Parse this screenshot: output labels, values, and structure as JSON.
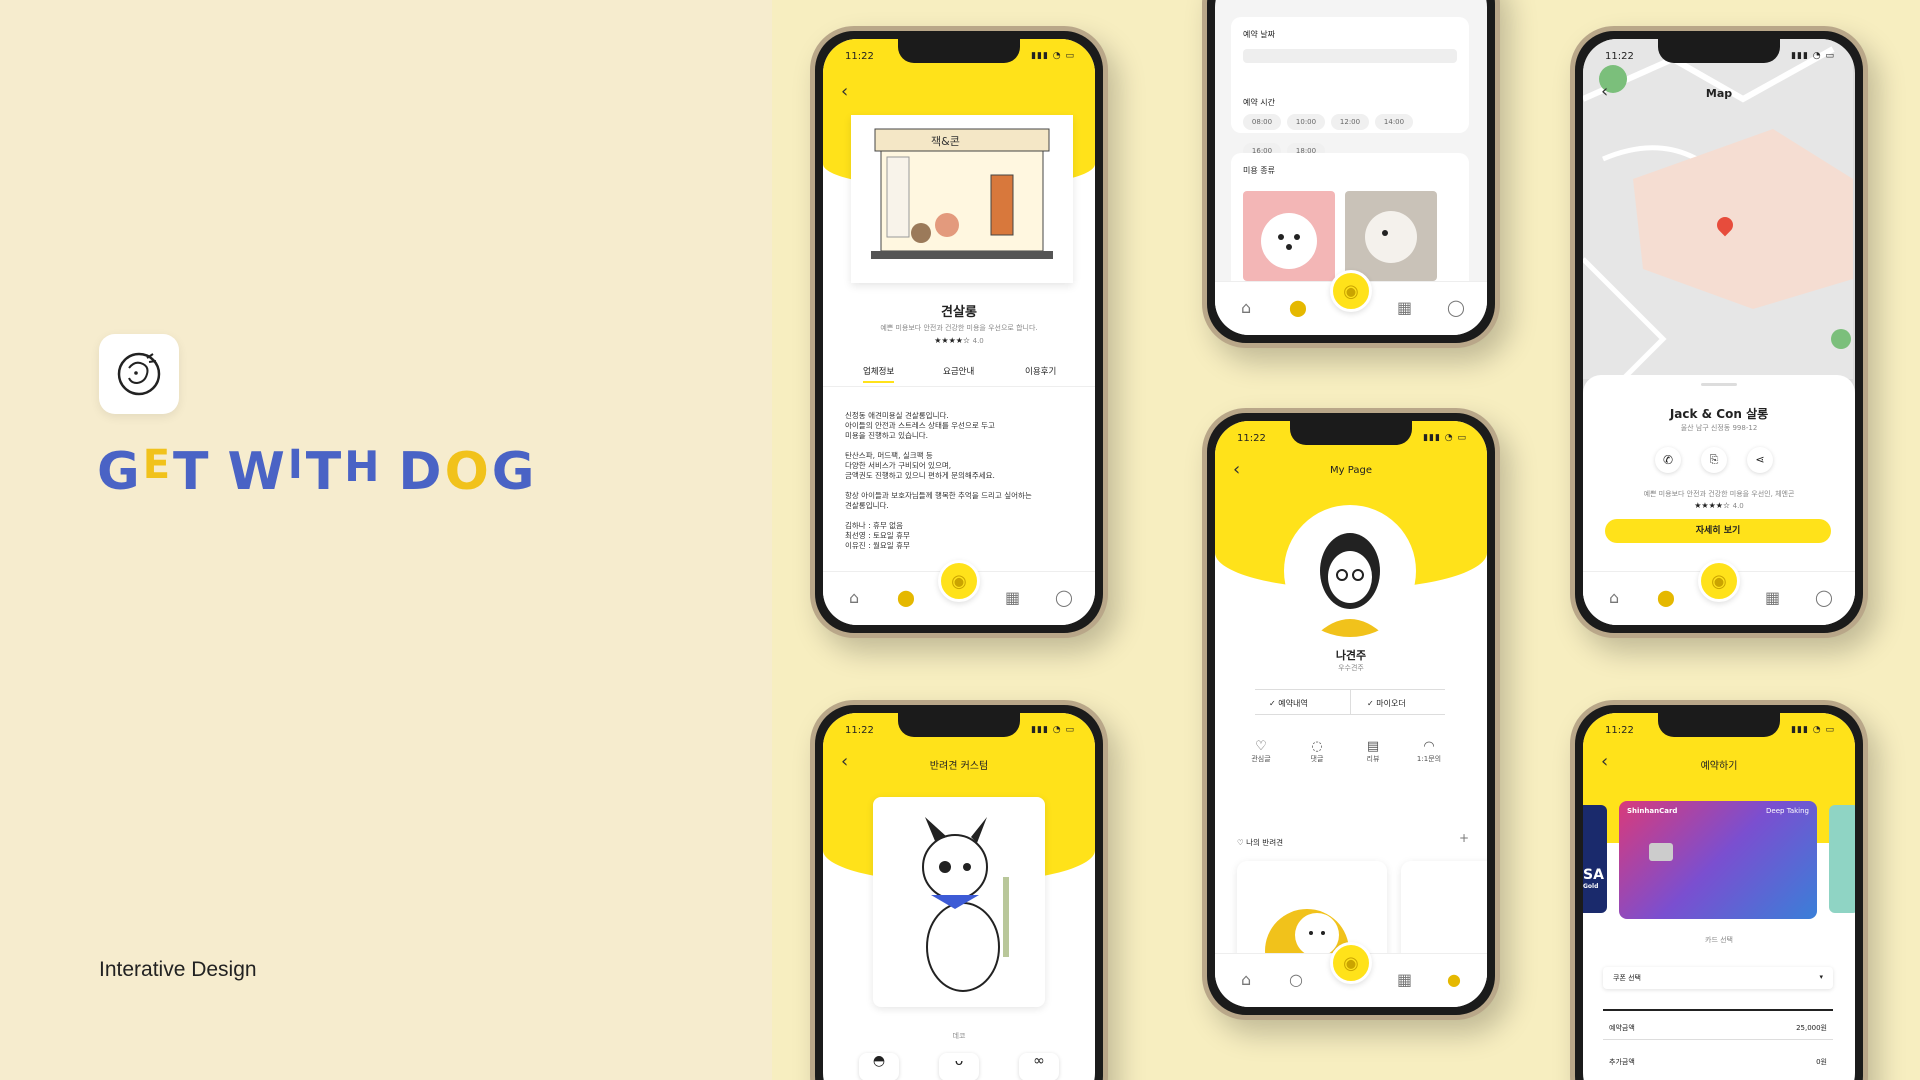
{
  "brand": {
    "name": "GET WITH DOG",
    "tagline": "Interative Design"
  },
  "status_time": "11:22",
  "salon": {
    "name": "견살롱",
    "desc": "예쁜 미용보다 안전과 건강한 미용을 우선으로 합니다.",
    "rating": "★★★★☆",
    "rating_value": "4.0",
    "tabs": [
      "업체정보",
      "요금안내",
      "이용후기"
    ],
    "sign": "잭&콘",
    "body": [
      "신정동 애견미용실 견살롱입니다.",
      "아이들의 안전과 스트레스 상태를 우선으로 두고",
      "미용을 진행하고 있습니다.",
      "",
      "탄산스파, 머드팩, 실크팩 등",
      "다양한 서비스가 구비되어 있으며,",
      "금액권도 진행하고 있으니 편하게 문의해주세요.",
      "",
      "항상 아이들과 보호자님들께 행복한 추억을 드리고 싶어하는",
      "견살롱입니다.",
      "",
      "김하나 : 휴무 없음",
      "최선영 : 토요일 휴무",
      "이유진 : 월요일 휴무"
    ]
  },
  "booking": {
    "date_label": "예약 날짜",
    "time_label": "예약 시간",
    "times": [
      "08:00",
      "10:00",
      "12:00",
      "14:00",
      "16:00",
      "18:00"
    ],
    "type_label": "미용 종류"
  },
  "map": {
    "title": "Map",
    "salon_name": "Jack & Con 살롱",
    "address": "울산 남구 신정동 998-12",
    "desc": "예쁜 미용보다 안전과 건강한 미용을 우선인, 체엔곤",
    "rating": "★★★★☆",
    "rating_value": "4.0",
    "button": "자세히 보기"
  },
  "mypage": {
    "title": "My Page",
    "user": "나견주",
    "user_sub": "우수견주",
    "btn1": "예약내역",
    "btn2": "마이오더",
    "menu": [
      "관심글",
      "댓글",
      "리뷰",
      "1:1문의"
    ],
    "pets_label": "나의 반려견",
    "add": "+"
  },
  "custom": {
    "title": "반려견 커스텀",
    "deco": "데코"
  },
  "payment": {
    "title": "예약하기",
    "card_brand": "ShinhanCard",
    "card_name": "Deep Taking",
    "visa": "SA",
    "visa_sub": "Gold",
    "select": "카드 선택",
    "coupon": "쿠폰 선택",
    "amount_label": "예약금액",
    "amount": "25,000원",
    "extra_label": "추가금액",
    "extra": "0원"
  },
  "colors": {
    "accent": "#ffe21a",
    "brand": "#4a63c5",
    "bg": "#f6ecce"
  }
}
